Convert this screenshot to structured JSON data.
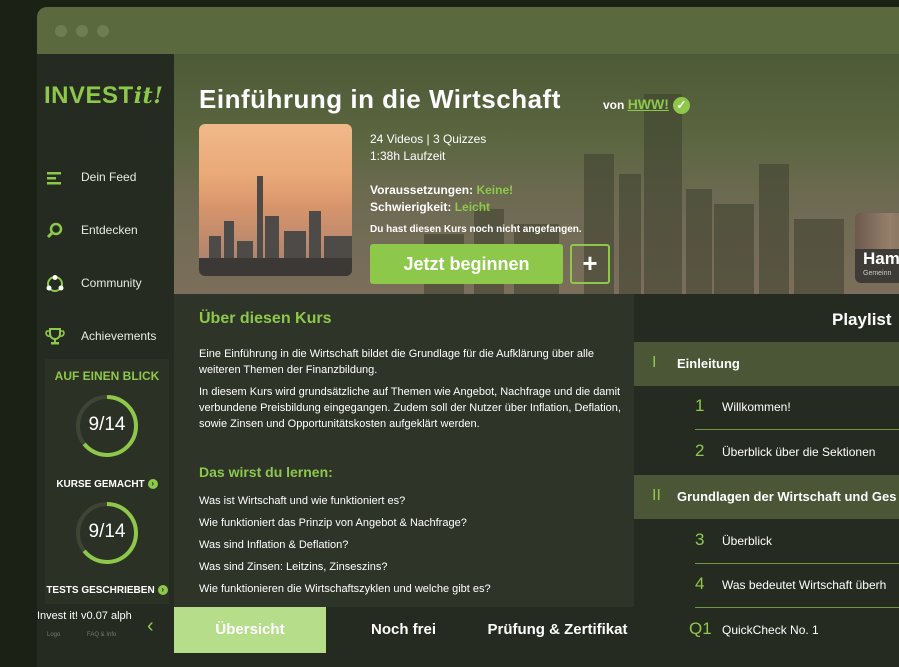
{
  "app": {
    "brand_main": "INVEST",
    "brand_suffix": "it!",
    "version": "Invest it! v0.07 alph",
    "footer_a": "Logo",
    "footer_b": "FAQ & Info"
  },
  "sidebar": {
    "items": [
      {
        "label": "Dein Feed",
        "icon": "feed-icon"
      },
      {
        "label": "Entdecken",
        "icon": "search-icon"
      },
      {
        "label": "Community",
        "icon": "community-icon"
      },
      {
        "label": "Achievements",
        "icon": "trophy-icon"
      }
    ],
    "overview": {
      "title": "AUF EINEN BLICK",
      "courses": {
        "value": "9/14",
        "fraction": 0.643,
        "label": "KURSE GEMACHT"
      },
      "tests": {
        "value": "9/14",
        "fraction": 0.643,
        "label": "TESTS GESCHRIEBEN"
      }
    }
  },
  "course": {
    "title": "Einführung in die Wirtschaft",
    "by_prefix": "von",
    "author": "HWW!",
    "stats": "24 Videos | 3 Quizzes",
    "duration": "1:38h Laufzeit",
    "prereq_label": "Voraussetzungen:",
    "prereq_value": "Keine!",
    "difficulty_label": "Schwierigkeit:",
    "difficulty_value": "Leicht",
    "progress_note": "Du hast diesen Kurs noch nicht angefangen.",
    "start_label": "Jetzt beginnen",
    "add_label": "+"
  },
  "side_card": {
    "title": "Ham",
    "subtitle": "Gemeinn"
  },
  "about": {
    "heading": "Über diesen Kurs",
    "p1": "Eine  Einführung in die Wirtschaft bildet die Grundlage für die Aufklärung über alle weiteren Themen der Finanzbildung.",
    "p2": "In diesem Kurs wird grundsätzliche auf Themen  wie Angebot, Nachfrage und die damit verbundene Preisbildung eingegangen. Zudem soll der Nutzer über Inflation, Deflation, sowie Zinsen und Opportunitätskosten aufgeklärt werden.",
    "learn_heading": "Das wirst du lernen:",
    "learn_items": [
      "Was ist Wirtschaft und wie funktioniert es?",
      "Wie funktioniert das Prinzip von Angebot & Nachfrage?",
      "Was sind Inflation & Deflation?",
      "Was sind Zinsen: Leitzins, Zinseszins?",
      "Wie funktionieren die Wirtschaftszyklen und welche gibt es?"
    ]
  },
  "playlist": {
    "title": "Playlist",
    "rows": [
      {
        "type": "section",
        "num": "I",
        "label": "Einleitung"
      },
      {
        "type": "item",
        "num": "1",
        "label": "Willkommen!"
      },
      {
        "type": "item",
        "num": "2",
        "label": "Überblick über die Sektionen"
      },
      {
        "type": "section",
        "num": "II",
        "label": "Grundlagen der Wirtschaft und Ges"
      },
      {
        "type": "item",
        "num": "3",
        "label": "Überblick"
      },
      {
        "type": "item",
        "num": "4",
        "label": "Was bedeutet Wirtschaft überh"
      },
      {
        "type": "item",
        "num": "Q1",
        "label": "QuickCheck No. 1"
      }
    ]
  },
  "tabs": [
    {
      "label": "Übersicht",
      "active": true
    },
    {
      "label": "Noch frei",
      "active": false
    },
    {
      "label": "Prüfung & Zertifikat",
      "active": false
    }
  ],
  "colors": {
    "accent": "#8dc84b",
    "sidebar": "#262b22",
    "section": "#4a5635"
  }
}
